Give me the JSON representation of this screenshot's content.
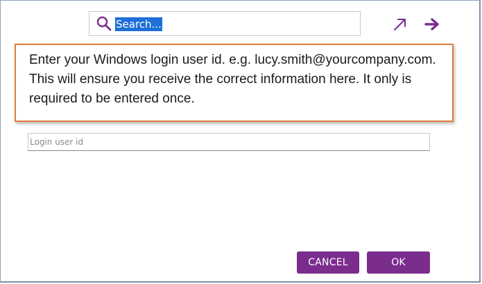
{
  "search": {
    "placeholder": "Search...",
    "selected_text": "Search..."
  },
  "icons": {
    "search": "search-icon",
    "expand": "expand-arrow-icon",
    "go": "arrow-right-icon",
    "accent_color": "#7b2d8e"
  },
  "callout": {
    "text": "Enter your Windows login user id. e.g. lucy.smith@yourcompany.com. This will ensure you receive the correct information here. It only is required to be entered once.",
    "border_color": "#e07b3c"
  },
  "login": {
    "placeholder": "Login user id",
    "value": ""
  },
  "buttons": {
    "cancel_label": "CANCEL",
    "ok_label": "OK",
    "color": "#7b2d8e"
  }
}
